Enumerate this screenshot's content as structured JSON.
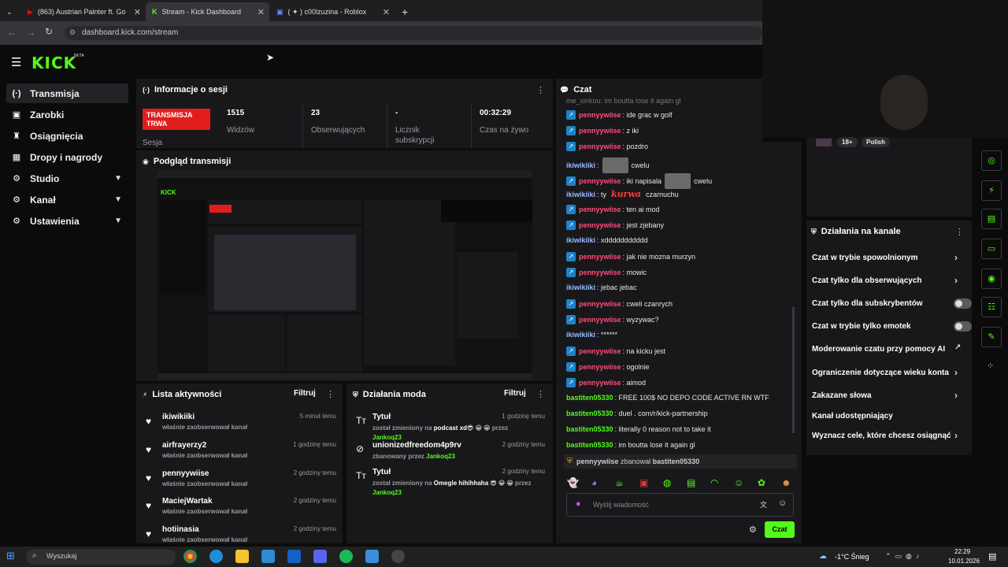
{
  "browser": {
    "tabs": [
      {
        "label": "(863) Austrian Painter ft. Go"
      },
      {
        "label": "Stream - Kick Dashboard"
      },
      {
        "label": "( ✦ ) c00lzuzina - Roblox"
      }
    ],
    "url": "dashboard.kick.com/stream"
  },
  "brand": {
    "logo": "KICK",
    "beta": "BETA",
    "accent": "#53fc18"
  },
  "sidebar": {
    "items": [
      {
        "label": "Transmisja",
        "icon": "broadcast-icon"
      },
      {
        "label": "Zarobki",
        "icon": "wallet-icon"
      },
      {
        "label": "Osiągnięcia",
        "icon": "trophy-icon"
      },
      {
        "label": "Dropy i nagrody",
        "icon": "gift-icon"
      },
      {
        "label": "Studio",
        "icon": "gear-icon"
      },
      {
        "label": "Kanał",
        "icon": "gear-icon"
      },
      {
        "label": "Ustawienia",
        "icon": "gear-icon"
      }
    ]
  },
  "session": {
    "title": "Informacje o sesji",
    "live_badge": "TRANSMISJA TRWA",
    "session_label": "Sesja",
    "stats": [
      {
        "value": "1515",
        "label": "Widzów"
      },
      {
        "value": "23",
        "label": "Obserwujących"
      },
      {
        "value": "-",
        "label": "Licznik subskrypcji"
      },
      {
        "value": "00:32:29",
        "label": "Czas na żywo"
      }
    ]
  },
  "preview": {
    "title": "Podgląd transmisji"
  },
  "activity": {
    "title": "Lista aktywności",
    "filter": "Filtruj",
    "items": [
      {
        "name": "ikiwikiiki",
        "sub": "właśnie zaobserwował kanał",
        "time": "5 minut temu"
      },
      {
        "name": "airfrayerzy2",
        "sub": "właśnie zaobserwował kanał",
        "time": "1 godzinę temu"
      },
      {
        "name": "pennyywiise",
        "sub": "właśnie zaobserwował kanał",
        "time": "2 godziny temu"
      },
      {
        "name": "MaciejWartak",
        "sub": "właśnie zaobserwował kanał",
        "time": "2 godziny temu"
      },
      {
        "name": "hotiinasia",
        "sub": "właśnie zaobserwował kanał",
        "time": "2 godziny temu"
      }
    ]
  },
  "mod_actions": {
    "title": "Działania moda",
    "filter": "Filtruj",
    "items": [
      {
        "name": "Tytuł",
        "pre": "został zmieniony na ",
        "bold": "podcast xd😎 😀 😀",
        "mid": " przez ",
        "by": "Jankoq23",
        "time": "1 godzinę temu"
      },
      {
        "name": "unionizedfreedom4p9rv",
        "pre": "zbanowany przez ",
        "bold": "",
        "mid": "",
        "by": "Jankoq23",
        "time": "2 godziny temu"
      },
      {
        "name": "Tytuł",
        "pre": "został zmieniony na ",
        "bold": "Omegle hihihhaha 😎 😀 😀",
        "mid": " przez ",
        "by": "Jankoq23",
        "time": "2 godziny temu"
      }
    ]
  },
  "chat": {
    "title": "Czat",
    "top_partial": "me_xinkou: im boutta lose it again gl",
    "messages": [
      {
        "user": "pennyywiise",
        "type": "p",
        "text": ": ide grac w golf"
      },
      {
        "user": "pennyywiise",
        "type": "p",
        "text": ": z iki"
      },
      {
        "user": "pennyywiise",
        "type": "p",
        "text": ": pozdro"
      },
      {
        "user": "ikiwikiiki",
        "type": "i",
        "text": ":",
        "emote": true,
        "after": "cwelu"
      },
      {
        "user": "pennyywiise",
        "type": "p",
        "text": ": iki napisala",
        "emote": true,
        "after": "cwelu"
      },
      {
        "user": "ikiwikiiki",
        "type": "i",
        "text": ": ty",
        "kurwa": "kurwa",
        "after": "czarnuchu"
      },
      {
        "user": "pennyywiise",
        "type": "p",
        "text": ": ten ai mod"
      },
      {
        "user": "pennyywiise",
        "type": "p",
        "text": ": jest zjebany"
      },
      {
        "user": "ikiwikiiki",
        "type": "i",
        "text": ": xddddddddddd"
      },
      {
        "user": "pennyywiise",
        "type": "p",
        "text": ": jak nie mozna murzyn"
      },
      {
        "user": "pennyywiise",
        "type": "p",
        "text": ": mowic"
      },
      {
        "user": "ikiwikiiki",
        "type": "i",
        "text": ": jebac jebac"
      },
      {
        "user": "pennyywiise",
        "type": "p",
        "text": ": cweli czanrych"
      },
      {
        "user": "pennyywiise",
        "type": "p",
        "text": ": wyzywac?"
      },
      {
        "user": "ikiwikiiki",
        "type": "i",
        "text": ": ******"
      },
      {
        "user": "pennyywiise",
        "type": "p",
        "text": ": na kicku jest"
      },
      {
        "user": "pennyywiise",
        "type": "p",
        "text": ": ogolnie"
      },
      {
        "user": "pennyywiise",
        "type": "p",
        "text": ": aimod"
      },
      {
        "user": "bastiten05330",
        "type": "b",
        "text": ": FREE 100$ NO DEPO CODE ACTIVE RN WTF"
      },
      {
        "user": "bastiten05330",
        "type": "b",
        "text": ": duel . com/r/kick-partnership"
      },
      {
        "user": "bastiten05330",
        "type": "b",
        "text": ": literally 0 reason not to take it"
      },
      {
        "user": "bastiten05330",
        "type": "b",
        "text": ": im boutta lose it again gl"
      }
    ],
    "ban_notice": {
      "user": "pennyywiise",
      "action": "zbanował",
      "target": "bastiten05330"
    },
    "input_placeholder": "Wyślij wiadomość",
    "send_label": "Czat"
  },
  "stream_info": {
    "age": "18+",
    "language": "Polish"
  },
  "channel_actions": {
    "title": "Działania na kanale",
    "items": [
      {
        "label": "Czat w trybie spowolnionym",
        "control": "chevron"
      },
      {
        "label": "Czat tylko dla obserwujących",
        "control": "chevron"
      },
      {
        "label": "Czat tylko dla subskrybentów",
        "control": "toggle"
      },
      {
        "label": "Czat w trybie tylko emotek",
        "control": "toggle"
      },
      {
        "label": "Moderowanie czatu przy pomocy AI",
        "control": "external"
      },
      {
        "label": "Ograniczenie dotyczące wieku konta",
        "control": "chevron"
      },
      {
        "label": "Zakazane słowa",
        "control": "chevron"
      },
      {
        "label": "Kanał udostępniający",
        "control": "none"
      },
      {
        "label": "Wyznacz cele, które chcesz osiągnąć",
        "control": "chevron"
      }
    ]
  },
  "taskbar": {
    "search_placeholder": "Wyszukaj",
    "weather": "-1°C Śnieg",
    "time": "22:29",
    "date": "10.01.2026"
  }
}
